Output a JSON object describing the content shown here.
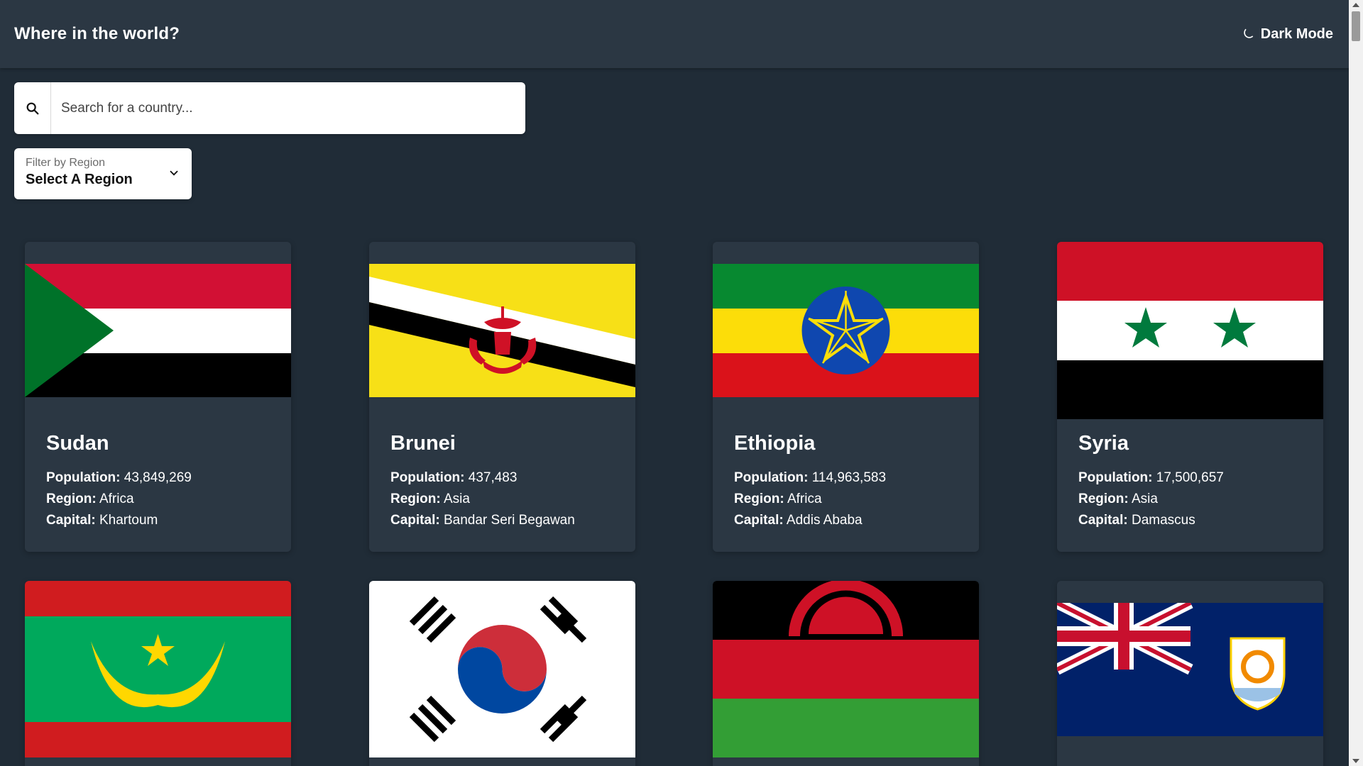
{
  "header": {
    "title": "Where in the world?",
    "dark_mode_label": "Dark Mode"
  },
  "search": {
    "placeholder": "Search for a country..."
  },
  "filter": {
    "label": "Filter by Region",
    "value": "Select A Region"
  },
  "labels": {
    "population": "Population:",
    "region": "Region:",
    "capital": "Capital:"
  },
  "countries": [
    {
      "name": "Sudan",
      "population": "43,849,269",
      "region": "Africa",
      "capital": "Khartoum"
    },
    {
      "name": "Brunei",
      "population": "437,483",
      "region": "Asia",
      "capital": "Bandar Seri Begawan"
    },
    {
      "name": "Ethiopia",
      "population": "114,963,583",
      "region": "Africa",
      "capital": "Addis Ababa"
    },
    {
      "name": "Syria",
      "population": "17,500,657",
      "region": "Asia",
      "capital": "Damascus"
    }
  ],
  "colors": {
    "background": "#202c37",
    "element": "#2b3743",
    "text": "#ffffff"
  }
}
